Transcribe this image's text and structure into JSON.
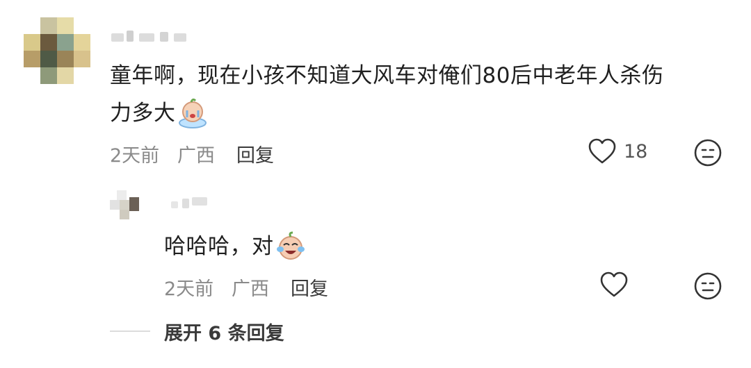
{
  "comment": {
    "text_line1": "童年啊，现在小孩不知道大风车对俺们80后中老年人杀伤",
    "text_line2": "力多大",
    "emoji": "crying-emoji",
    "time": "2天前",
    "location": "广西",
    "reply_label": "回复",
    "like_count": "18"
  },
  "reply": {
    "text": "哈哈哈，对",
    "emoji": "laughing-crying-emoji",
    "time": "2天前",
    "location": "广西",
    "reply_label": "回复"
  },
  "expand_label": "展开 6 条回复",
  "colors": {
    "meta": "#8a8a8a",
    "text": "#1f1f1f",
    "icon": "#333333"
  }
}
